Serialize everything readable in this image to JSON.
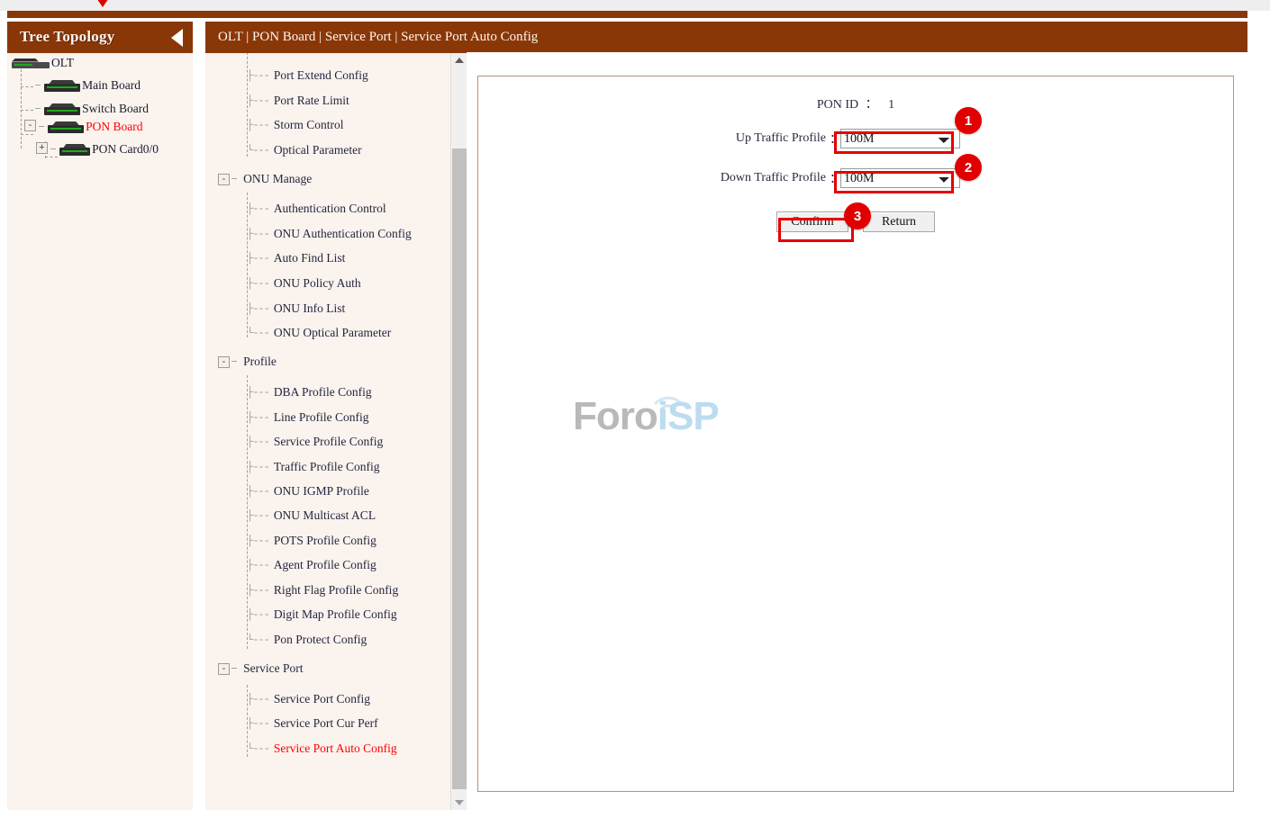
{
  "window": {
    "top_arrow_icon": "red-down-triangle"
  },
  "sidebar": {
    "title": "Tree Topology",
    "collapse_icon": "collapse-left-arrow",
    "tree": [
      {
        "label": "OLT",
        "icon": "olt-device-icon",
        "expander": null,
        "highlight": false
      },
      {
        "label": "Main Board",
        "icon": "board-device-icon",
        "expander": null,
        "highlight": false
      },
      {
        "label": "Switch Board",
        "icon": "board-device-icon",
        "expander": null,
        "highlight": false
      },
      {
        "label": "PON Board",
        "icon": "board-device-icon",
        "expander": "-",
        "highlight": true
      },
      {
        "label": "PON Card0/0",
        "icon": "board-device-icon",
        "expander": "+",
        "highlight": false
      }
    ]
  },
  "header": {
    "breadcrumb": "OLT | PON Board | Service Port | Service Port Auto Config"
  },
  "nav": {
    "items": [
      {
        "label": "Port Extend Config",
        "type": "leaf",
        "highlight": false
      },
      {
        "label": "Port Rate Limit",
        "type": "leaf",
        "highlight": false
      },
      {
        "label": "Storm Control",
        "type": "leaf",
        "highlight": false
      },
      {
        "label": "Optical Parameter",
        "type": "leaf",
        "highlight": false,
        "last": true
      },
      {
        "label": "ONU Manage",
        "type": "group",
        "expander": "-"
      },
      {
        "label": "Authentication Control",
        "type": "leaf",
        "highlight": false
      },
      {
        "label": "ONU Authentication Config",
        "type": "leaf",
        "highlight": false
      },
      {
        "label": "Auto Find List",
        "type": "leaf",
        "highlight": false
      },
      {
        "label": "ONU Policy Auth",
        "type": "leaf",
        "highlight": false
      },
      {
        "label": "ONU Info List",
        "type": "leaf",
        "highlight": false
      },
      {
        "label": "ONU Optical Parameter",
        "type": "leaf",
        "highlight": false,
        "last": true
      },
      {
        "label": "Profile",
        "type": "group",
        "expander": "-"
      },
      {
        "label": "DBA Profile Config",
        "type": "leaf",
        "highlight": false
      },
      {
        "label": "Line Profile Config",
        "type": "leaf",
        "highlight": false
      },
      {
        "label": "Service Profile Config",
        "type": "leaf",
        "highlight": false
      },
      {
        "label": "Traffic Profile Config",
        "type": "leaf",
        "highlight": false
      },
      {
        "label": "ONU IGMP Profile",
        "type": "leaf",
        "highlight": false
      },
      {
        "label": "ONU Multicast ACL",
        "type": "leaf",
        "highlight": false
      },
      {
        "label": "POTS Profile Config",
        "type": "leaf",
        "highlight": false
      },
      {
        "label": "Agent Profile Config",
        "type": "leaf",
        "highlight": false
      },
      {
        "label": "Right Flag Profile Config",
        "type": "leaf",
        "highlight": false
      },
      {
        "label": "Digit Map Profile Config",
        "type": "leaf",
        "highlight": false
      },
      {
        "label": "Pon Protect Config",
        "type": "leaf",
        "highlight": false,
        "last": true
      },
      {
        "label": "Service Port",
        "type": "group",
        "expander": "-"
      },
      {
        "label": "Service Port Config",
        "type": "leaf",
        "highlight": false
      },
      {
        "label": "Service Port Cur Perf",
        "type": "leaf",
        "highlight": false
      },
      {
        "label": "Service Port Auto Config",
        "type": "leaf",
        "highlight": true,
        "last": true
      }
    ],
    "scrollbar": {
      "up_icon": "scroll-up-arrow",
      "down_icon": "scroll-down-arrow"
    }
  },
  "form": {
    "pon_id_label": "PON ID",
    "pon_id_colon": "：",
    "pon_id_value": "1",
    "up_traffic_label": "Up Traffic Profile",
    "up_traffic_colon": "：",
    "up_traffic_value": "100M",
    "up_traffic_options": [
      "100M"
    ],
    "down_traffic_label": "Down Traffic Profile",
    "down_traffic_colon": "：",
    "down_traffic_value": "100M",
    "down_traffic_options": [
      "100M"
    ],
    "confirm_label": "Confirm",
    "return_label": "Return"
  },
  "annotations": {
    "badge_1": "1",
    "badge_2": "2",
    "badge_3": "3",
    "accent_color": "#e00000"
  },
  "watermark": {
    "part1": "Foro",
    "part2": "i",
    "part3": "SP",
    "signal_icon": "wifi-arc-icon"
  }
}
